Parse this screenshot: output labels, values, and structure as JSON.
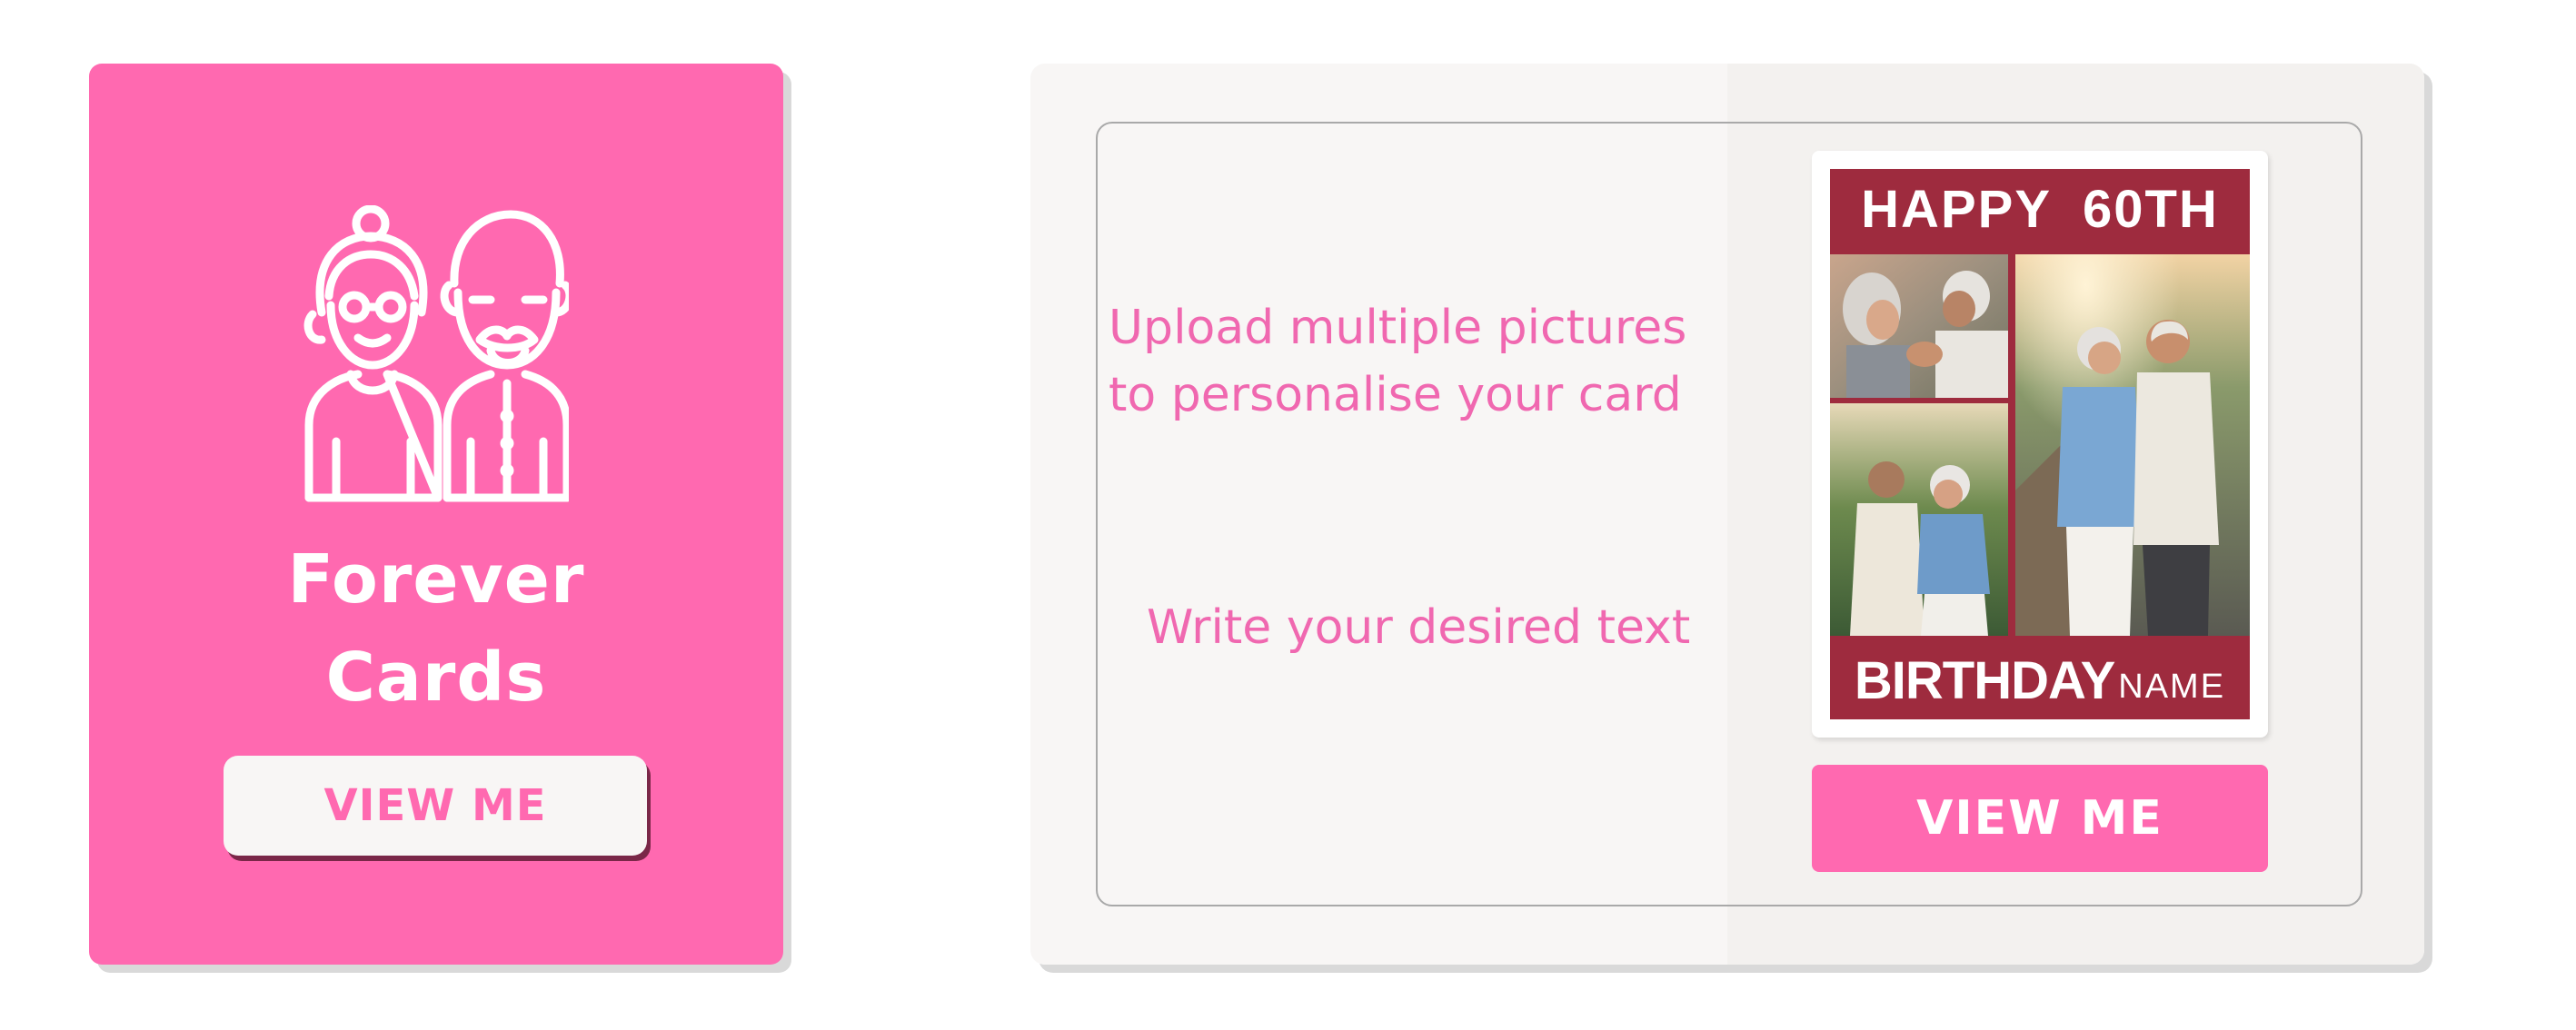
{
  "left_card": {
    "title_line1": "Forever",
    "title_line2": "Cards",
    "button_label": "VIEW ME",
    "icon": "elderly-couple-icon",
    "background": "#ff69b0"
  },
  "right_panel": {
    "upload_line1": "Upload multiple pictures",
    "upload_line2": "to personalise your card",
    "write_text": "Write your desired text",
    "card_preview": {
      "header_word1": "HAPPY",
      "header_word2": "60TH",
      "footer_big": "BIRTHDAY",
      "footer_small": "NAME",
      "frame_color": "#9e2b3e"
    },
    "button_label": "VIEW ME"
  },
  "colors": {
    "accent_pink": "#ff69b0",
    "text_pink": "#f068b0",
    "panel_bg": "#f8f6f5",
    "card_red": "#9e2b3e"
  }
}
